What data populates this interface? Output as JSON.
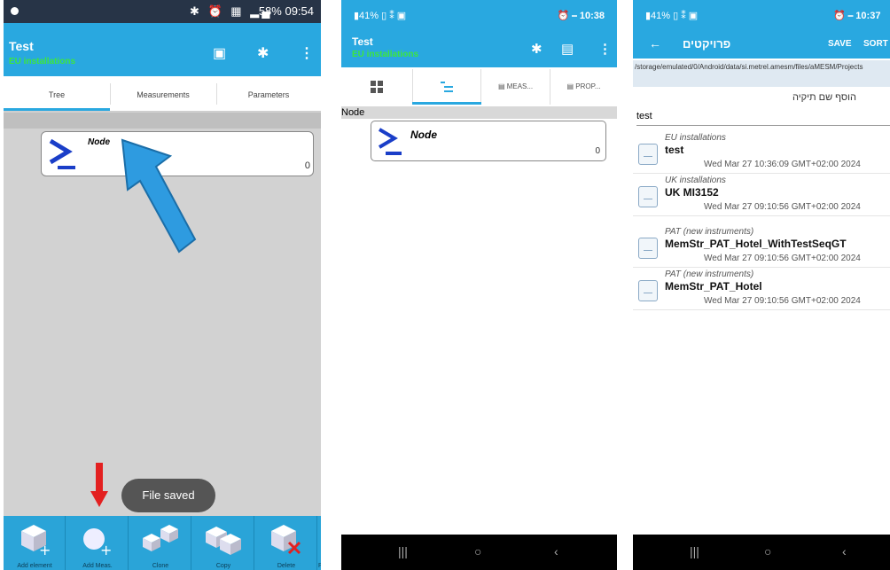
{
  "screen1": {
    "status": {
      "icons": "✱ ⏰ ▦ ▂▄",
      "battery_time": "58% 09:54"
    },
    "appbar": {
      "title": "Test",
      "subtitle": "EU installations"
    },
    "tabs": [
      "Tree",
      "Measurements",
      "Parameters"
    ],
    "node": {
      "label": "Node",
      "count": "0"
    },
    "toast": "File saved",
    "toolbar": [
      "Add element",
      "Add Meas.",
      "Clone",
      "Copy",
      "Delete",
      "Pa"
    ]
  },
  "screen2": {
    "status": {
      "left": "▮41% ▯ ⁑ ▣",
      "right": "⏰ ⎯ 10:38"
    },
    "appbar": {
      "title": "Test",
      "subtitle": "EU installations"
    },
    "tabs": [
      "MEAS...",
      "PROP..."
    ],
    "band": "Node",
    "node": {
      "label": "Node",
      "count": "0"
    },
    "nav": [
      "|||",
      "○",
      "‹"
    ]
  },
  "screen3": {
    "status": {
      "left": "▮41% ▯ ⁑ ▣",
      "right": "⏰ ⎯ 10:37"
    },
    "appbar": {
      "back": "←",
      "title": "פרויקטים",
      "save": "SAVE",
      "sort": "SORT"
    },
    "path": "/storage/emulated/0/Android/data/si.metrel.amesm/files/aMESM/Projects",
    "add_folder": "הוסף שם תיקיה",
    "field_value": "test",
    "projects": [
      {
        "category": "EU installations",
        "name": "test",
        "date": "Wed Mar 27 10:36:09 GMT+02:00 2024"
      },
      {
        "category": "UK installations",
        "name": "UK MI3152",
        "date": "Wed Mar 27 09:10:56 GMT+02:00 2024"
      },
      {
        "category": "PAT (new instruments)",
        "name": "MemStr_PAT_Hotel_WithTestSeqGT",
        "date": "Wed Mar 27 09:10:56 GMT+02:00 2024"
      },
      {
        "category": "PAT (new instruments)",
        "name": "MemStr_PAT_Hotel",
        "date": "Wed Mar 27 09:10:56 GMT+02:00 2024"
      }
    ],
    "nav": [
      "|||",
      "○",
      "‹"
    ]
  },
  "colors": {
    "primary": "#29a8e0",
    "status_dark": "#273447",
    "subtitle_green": "#3de63d",
    "arrow_blue": "#2e9be0",
    "arrow_red": "#e32020"
  }
}
